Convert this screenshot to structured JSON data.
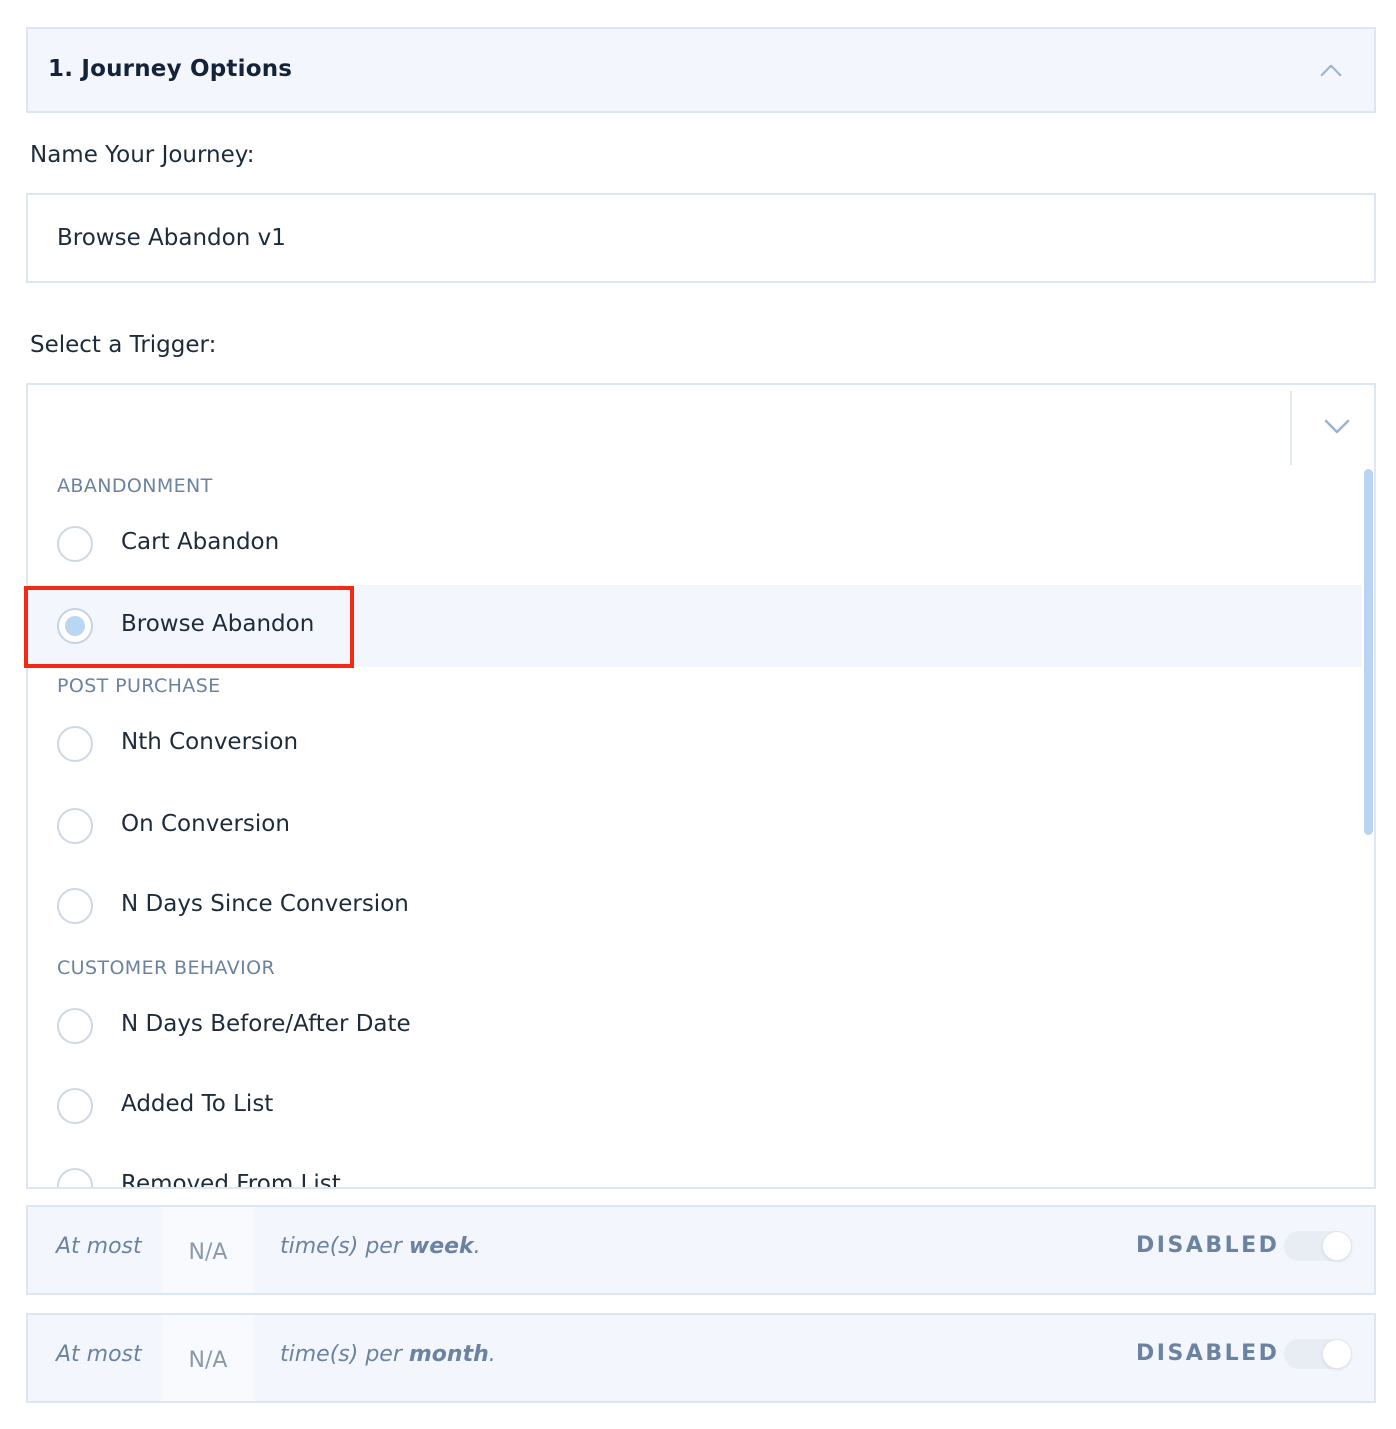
{
  "section": {
    "title": "1. Journey Options"
  },
  "name_field": {
    "label": "Name Your Journey:",
    "value": "Browse Abandon v1"
  },
  "trigger_field": {
    "label": "Select a Trigger:",
    "groups": [
      {
        "label": "ABANDONMENT",
        "options": [
          {
            "label": "Cart Abandon",
            "selected": false
          },
          {
            "label": "Browse Abandon",
            "selected": true
          }
        ]
      },
      {
        "label": "POST PURCHASE",
        "options": [
          {
            "label": "Nth Conversion",
            "selected": false
          },
          {
            "label": "On Conversion",
            "selected": false
          },
          {
            "label": "N Days Since Conversion",
            "selected": false
          }
        ]
      },
      {
        "label": "CUSTOMER BEHAVIOR",
        "options": [
          {
            "label": "N Days Before/After Date",
            "selected": false
          },
          {
            "label": "Added To List",
            "selected": false
          },
          {
            "label": "Removed From List",
            "selected": false
          }
        ]
      }
    ]
  },
  "limits": [
    {
      "prefix": "At most",
      "value": "N/A",
      "suffix_start": "time(s) per ",
      "period": "week",
      "suffix_end": ".",
      "status": "DISABLED",
      "enabled": false
    },
    {
      "prefix": "At most",
      "value": "N/A",
      "suffix_start": "time(s) per ",
      "period": "month",
      "suffix_end": ".",
      "status": "DISABLED",
      "enabled": false
    }
  ],
  "colors": {
    "highlight": "#f22a14",
    "accent": "#b9d6f3",
    "muted_text": "#6b82a0"
  },
  "icons": {
    "collapse": "chevron-up-icon",
    "dropdown": "chevron-down-icon"
  }
}
